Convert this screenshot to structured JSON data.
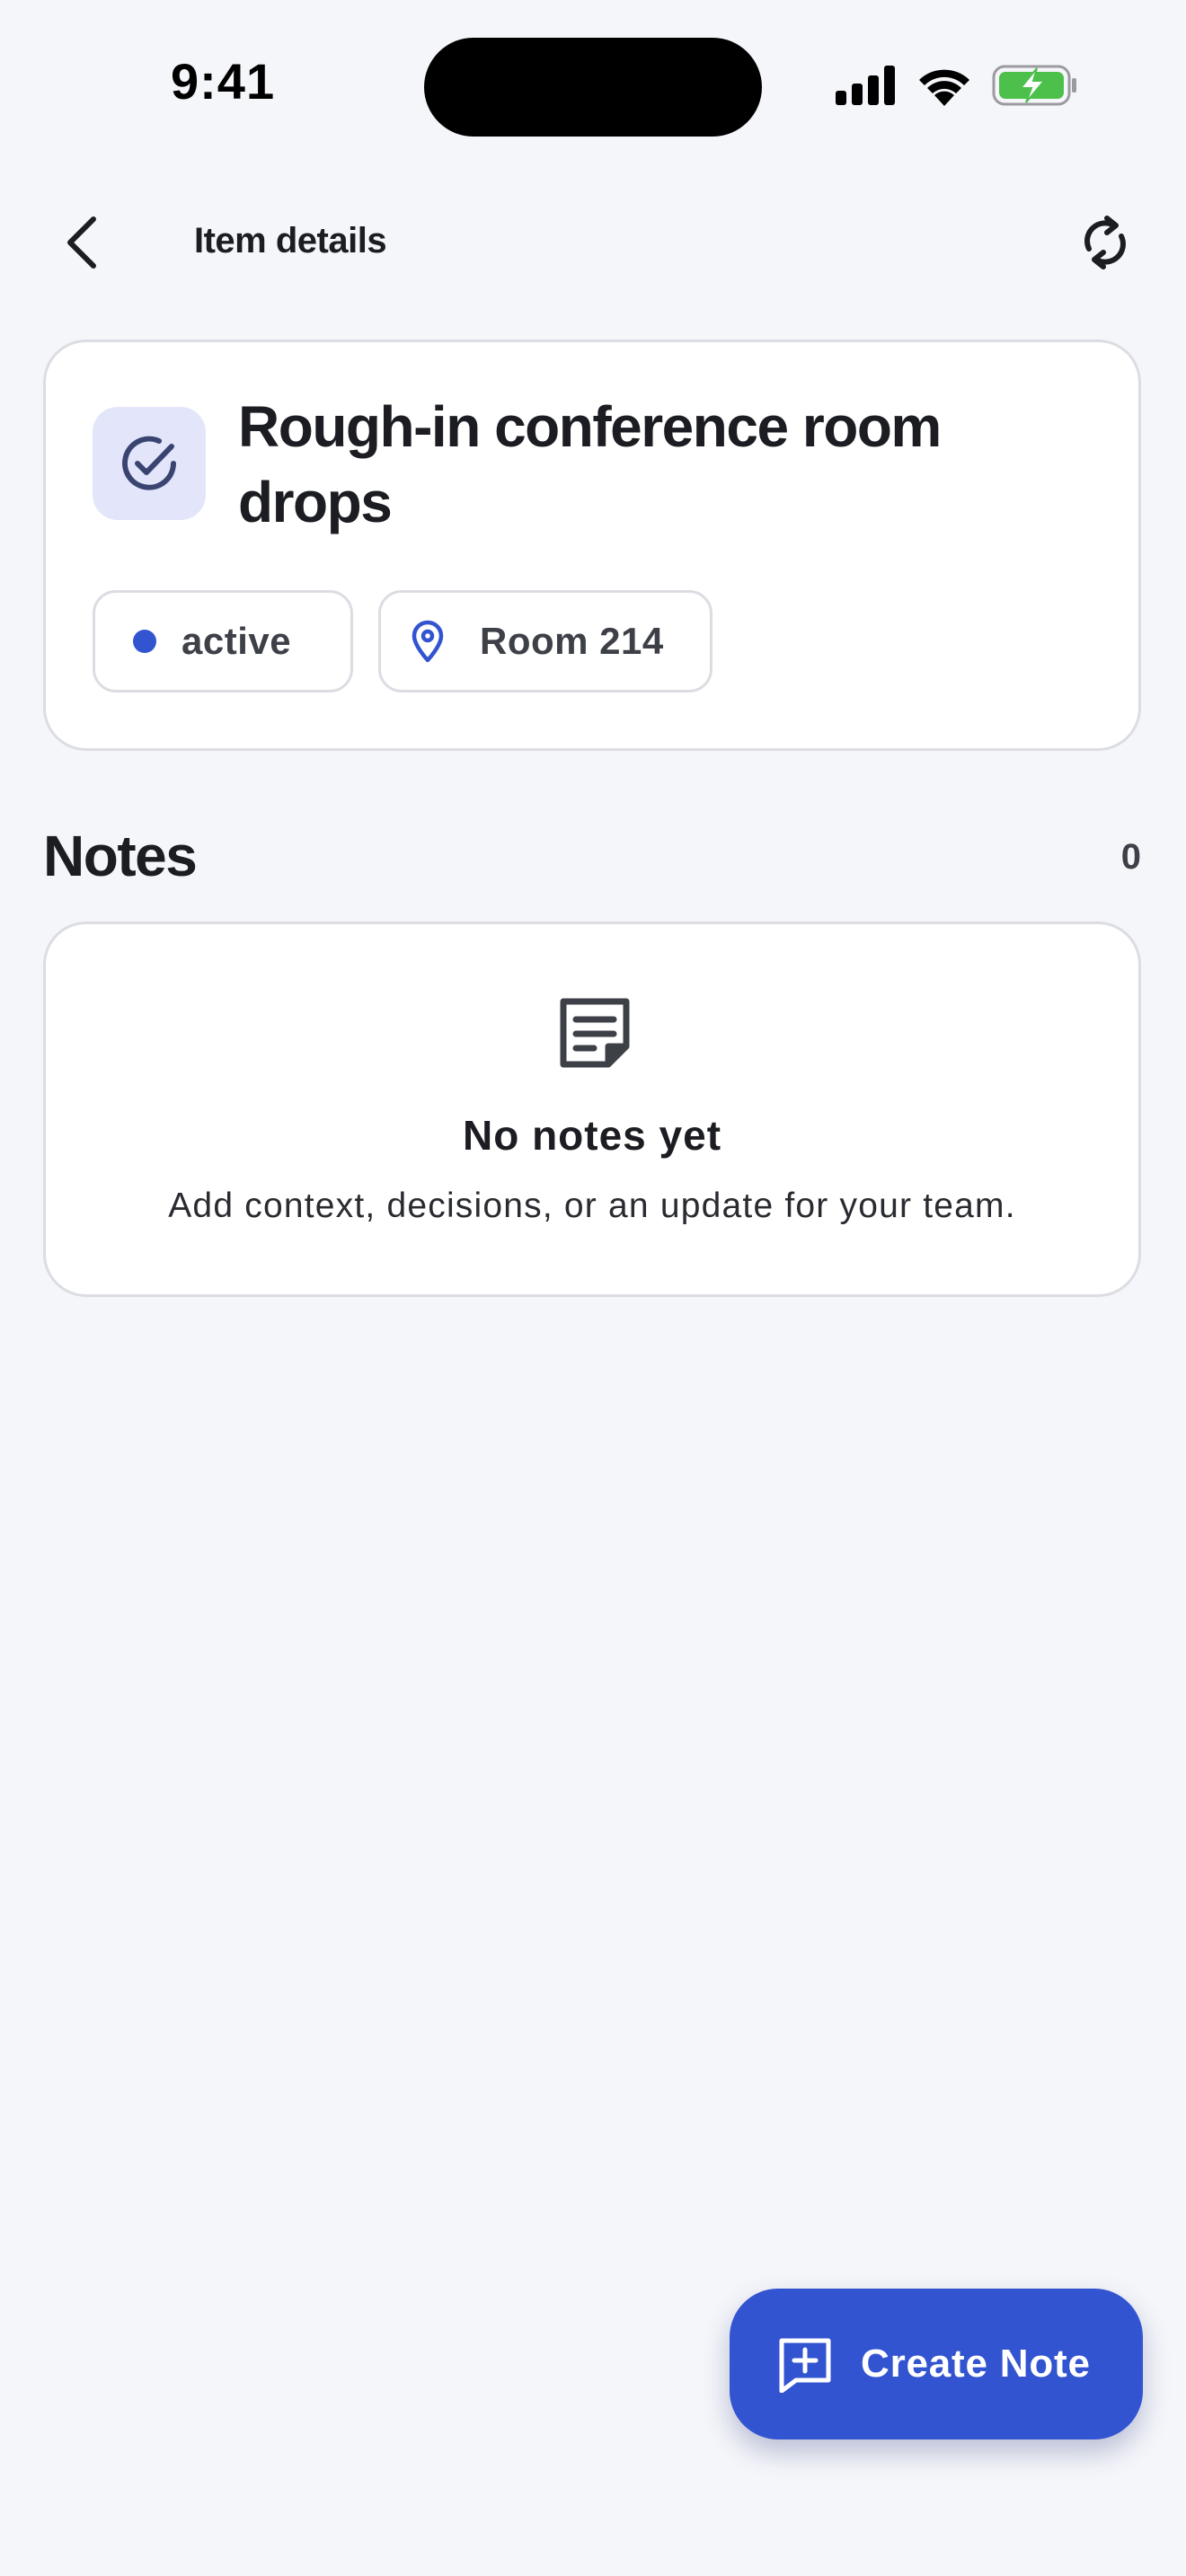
{
  "status_bar": {
    "time": "9:41"
  },
  "nav": {
    "title": "Item details",
    "back_icon": "chevron-left-icon",
    "refresh_icon": "refresh-icon"
  },
  "item": {
    "title": "Rough-in conference room drops",
    "icon": "check-circle-icon",
    "status": "active",
    "location": "Room 214"
  },
  "notes": {
    "section_title": "Notes",
    "count": "0",
    "empty_title": "No notes yet",
    "empty_subtitle": "Add context, decisions, or an update for your team.",
    "empty_icon": "sticky-note-icon"
  },
  "fab": {
    "label": "Create Note",
    "icon": "add-comment-icon"
  },
  "colors": {
    "accent": "#3354d1",
    "background": "#f5f6fa",
    "card_border": "#dcdde3",
    "icon_tile": "#e3e6fb",
    "battery_green": "#4cc04a"
  }
}
